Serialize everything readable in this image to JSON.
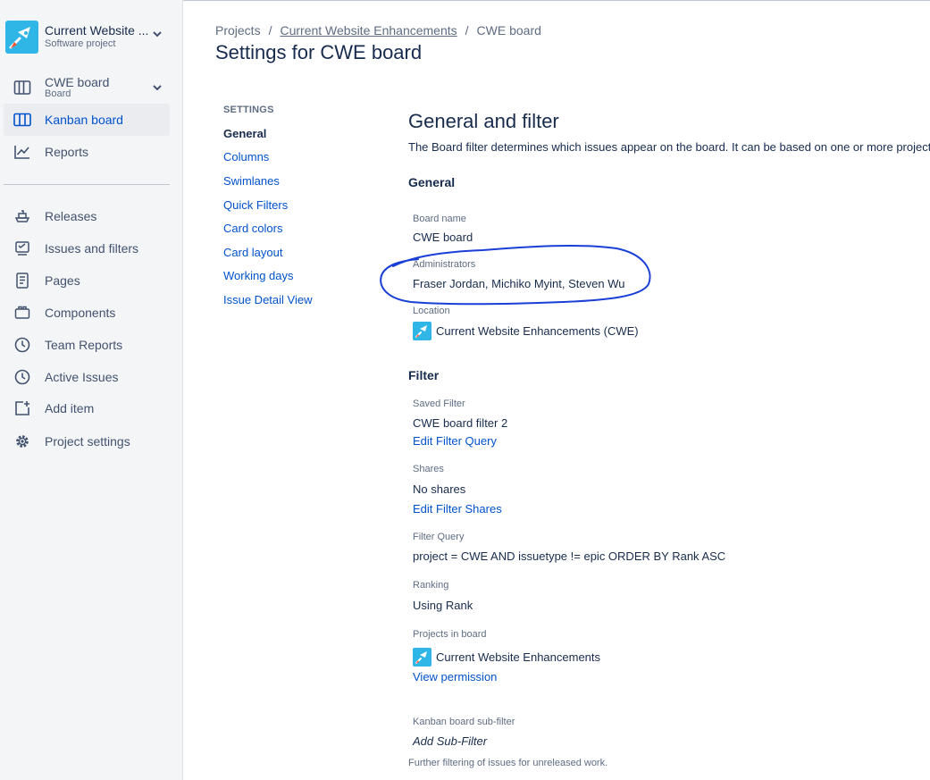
{
  "sidebar": {
    "project": {
      "name": "Current Website ...",
      "type": "Software project"
    },
    "board": {
      "name": "CWE board",
      "type": "Board"
    },
    "items_top": [
      {
        "label": "Kanban board",
        "icon": "kanban-columns-icon",
        "active": true
      },
      {
        "label": "Reports",
        "icon": "chart-line-icon"
      }
    ],
    "items_bottom": [
      {
        "label": "Releases",
        "icon": "ship-icon"
      },
      {
        "label": "Issues and filters",
        "icon": "issues-icon"
      },
      {
        "label": "Pages",
        "icon": "page-icon"
      },
      {
        "label": "Components",
        "icon": "components-icon"
      },
      {
        "label": "Team Reports",
        "icon": "clock-icon"
      },
      {
        "label": "Active Issues",
        "icon": "clock-icon"
      },
      {
        "label": "Add item",
        "icon": "add-item-icon"
      },
      {
        "label": "Project settings",
        "icon": "gear-icon"
      }
    ]
  },
  "breadcrumb": {
    "items": [
      "Projects",
      "Current Website Enhancements",
      "CWE board"
    ],
    "separator": "/"
  },
  "page_title": "Settings for CWE board",
  "settings_nav": {
    "heading": "SETTINGS",
    "items": [
      "General",
      "Columns",
      "Swimlanes",
      "Quick Filters",
      "Card colors",
      "Card layout",
      "Working days",
      "Issue Detail View"
    ]
  },
  "section": {
    "title": "General and filter",
    "description": "The Board filter determines which issues appear on the board. It can be based on one or more projects, o"
  },
  "general": {
    "heading": "General",
    "board_name_label": "Board name",
    "board_name": "CWE board",
    "administrators_label": "Administrators",
    "administrators": "Fraser Jordan, Michiko Myint, Steven Wu",
    "location_label": "Location",
    "location": "Current Website Enhancements (CWE)"
  },
  "filter": {
    "heading": "Filter",
    "saved_filter_label": "Saved Filter",
    "saved_filter": "CWE board filter 2",
    "edit_filter_query": "Edit Filter Query",
    "shares_label": "Shares",
    "shares": "No shares",
    "edit_filter_shares": "Edit Filter Shares",
    "filter_query_label": "Filter Query",
    "filter_query": "project = CWE AND issuetype != epic ORDER BY Rank ASC",
    "ranking_label": "Ranking",
    "ranking": "Using Rank",
    "projects_label": "Projects in board",
    "project": "Current Website Enhancements",
    "view_permission": "View permission",
    "subfilter_label": "Kanban board sub-filter",
    "add_subfilter": "Add Sub-Filter",
    "subfilter_note": "Further filtering of issues for unreleased work."
  },
  "colors": {
    "link": "#0052cc",
    "text": "#172b4d",
    "muted": "#5e6c84",
    "sidebar_bg": "#f4f5f7",
    "annotation": "#1a3fd6",
    "logo": "#2fb5e6"
  }
}
